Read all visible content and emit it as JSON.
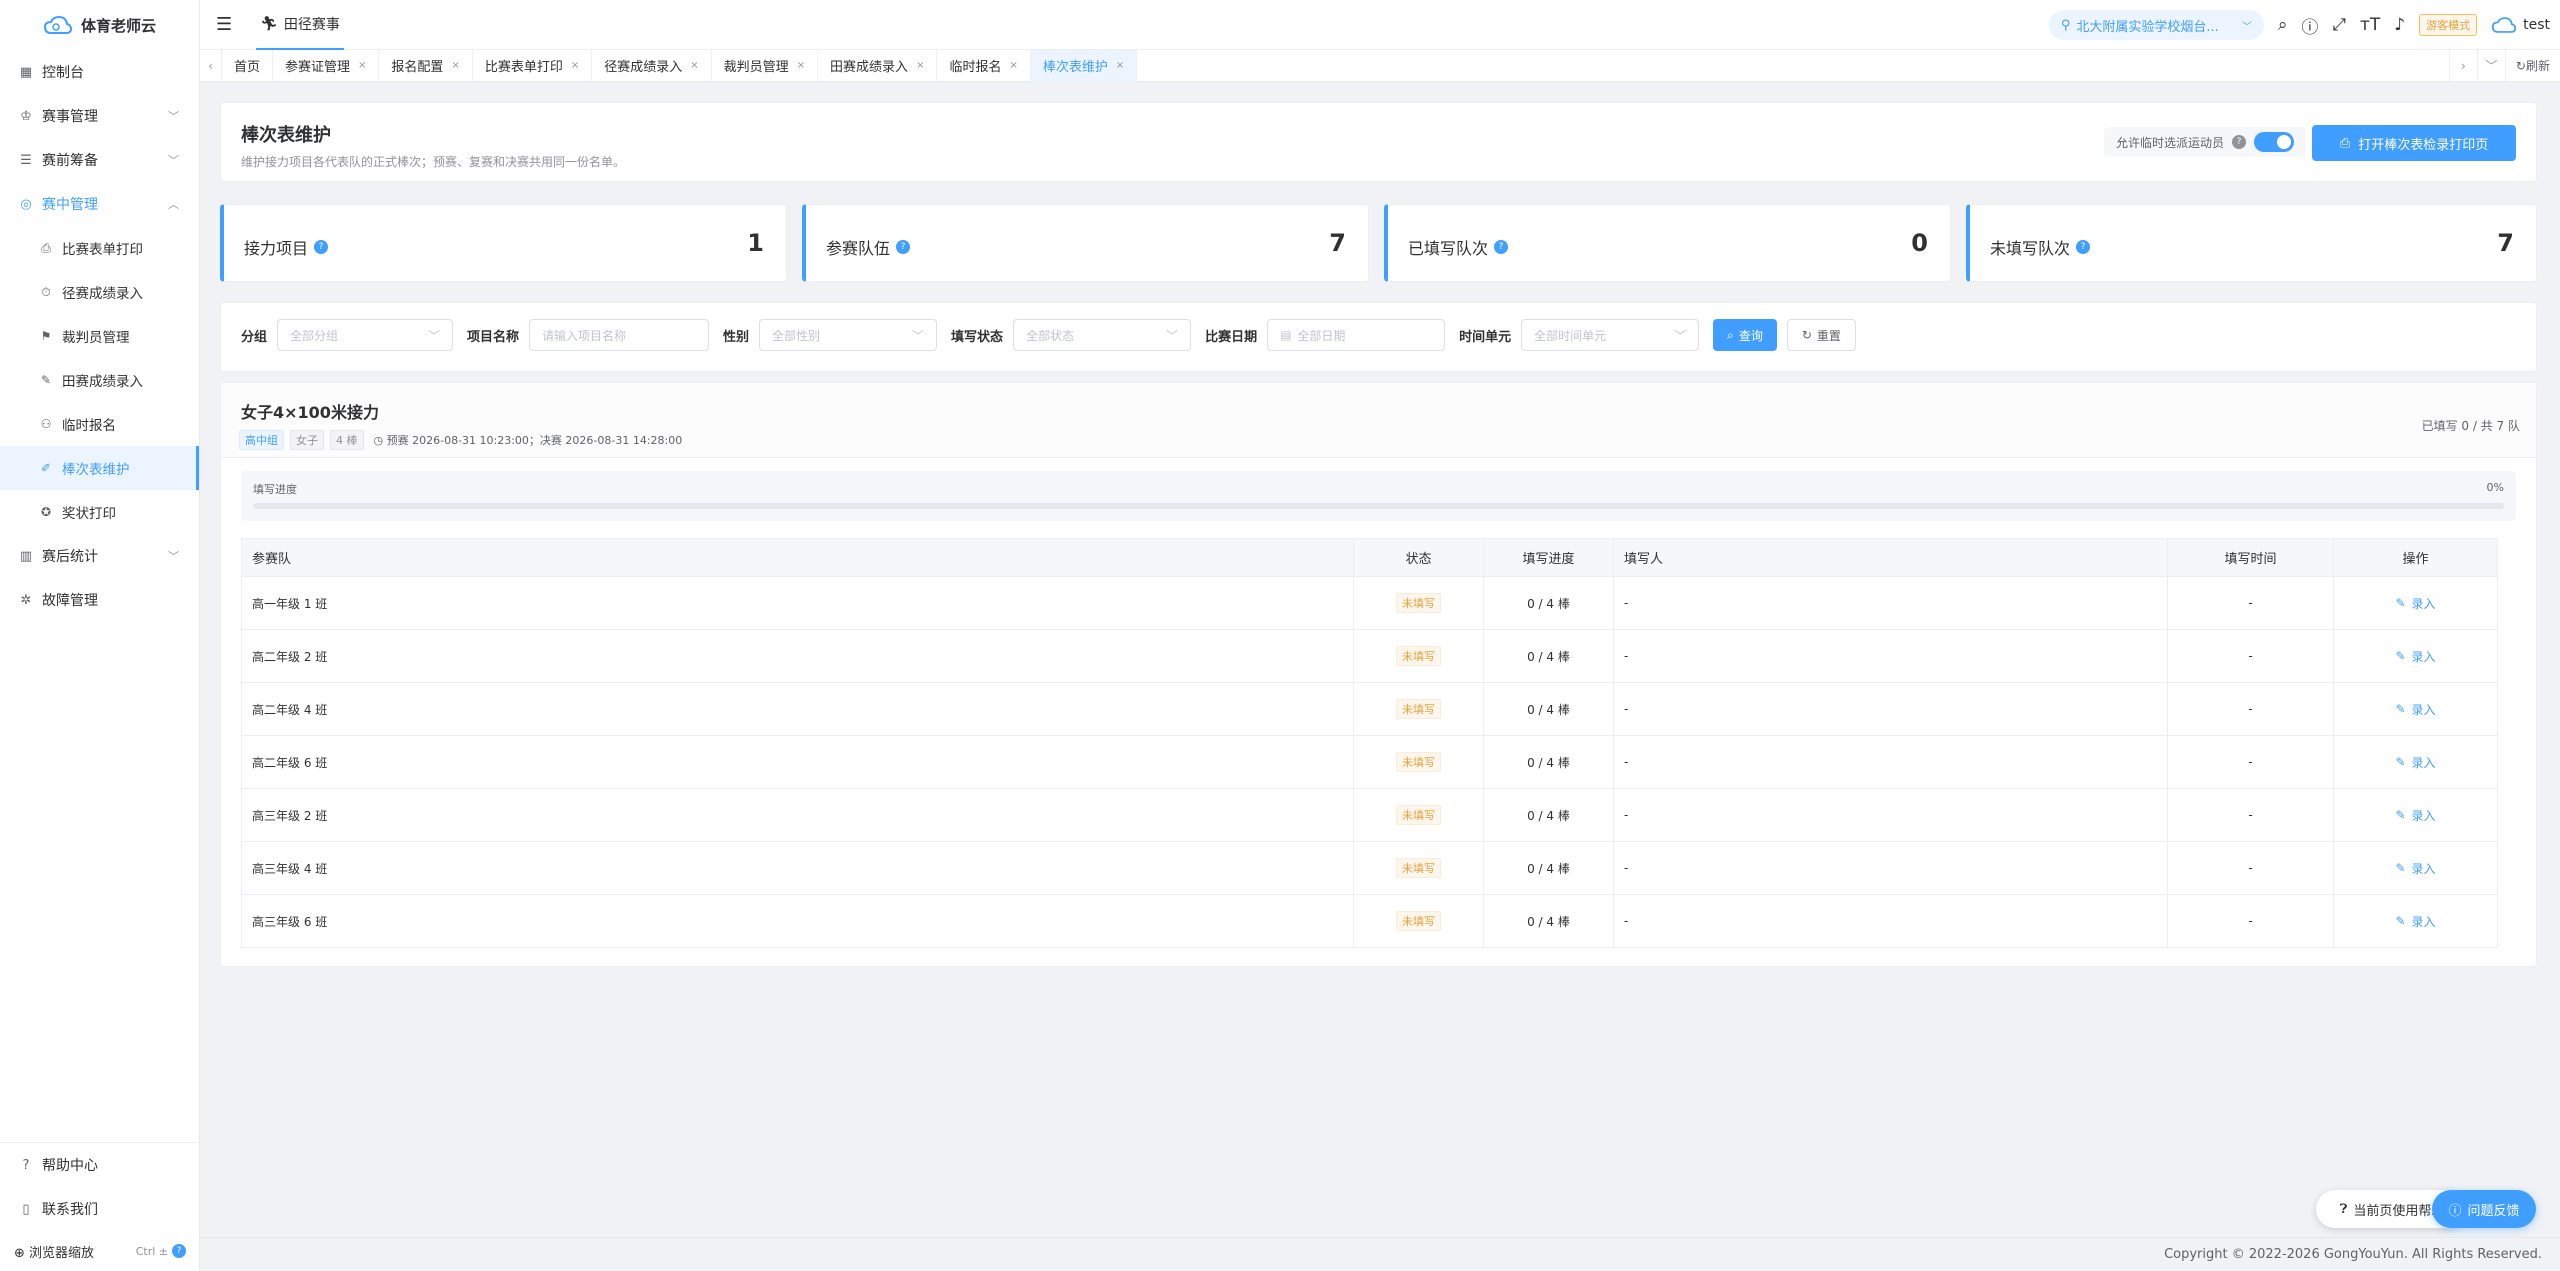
{
  "app": {
    "name": "体育老师云"
  },
  "sidebar": {
    "items": [
      {
        "label": "控制台",
        "icon": "dashboard-icon"
      },
      {
        "label": "赛事管理",
        "icon": "trophy-icon"
      },
      {
        "label": "赛前筹备",
        "icon": "prep-icon"
      },
      {
        "label": "赛中管理",
        "icon": "in-match-icon"
      },
      {
        "label": "赛后统计",
        "icon": "stats-icon"
      },
      {
        "label": "故障管理",
        "icon": "bug-icon"
      }
    ],
    "sub_items": [
      {
        "label": "比赛表单打印"
      },
      {
        "label": "径赛成绩录入"
      },
      {
        "label": "裁判员管理"
      },
      {
        "label": "田赛成绩录入"
      },
      {
        "label": "临时报名"
      },
      {
        "label": "棒次表维护"
      },
      {
        "label": "奖状打印"
      }
    ],
    "bottom": [
      {
        "label": "帮助中心"
      },
      {
        "label": "联系我们"
      }
    ],
    "zoom": {
      "label": "浏览器缩放",
      "hint": "Ctrl ±"
    }
  },
  "topbar": {
    "current_module": "田径赛事",
    "school": "北大附属实验学校烟台...",
    "mode": "游客模式",
    "user": "test"
  },
  "tags": [
    {
      "label": "首页"
    },
    {
      "label": "参赛证管理"
    },
    {
      "label": "报名配置"
    },
    {
      "label": "比赛表单打印"
    },
    {
      "label": "径赛成绩录入"
    },
    {
      "label": "裁判员管理"
    },
    {
      "label": "田赛成绩录入"
    },
    {
      "label": "临时报名"
    },
    {
      "label": "棒次表维护"
    }
  ],
  "tags_refresh": "刷新",
  "page": {
    "title": "棒次表维护",
    "subtitle": "维护接力项目各代表队的正式棒次；预赛、复赛和决赛共用同一份名单。",
    "toggle_label": "允许临时选派运动员",
    "toggle_on": true,
    "print_button": "打开棒次表检录打印页"
  },
  "stats": [
    {
      "label": "接力项目",
      "value": "1"
    },
    {
      "label": "参赛队伍",
      "value": "7"
    },
    {
      "label": "已填写队次",
      "value": "0"
    },
    {
      "label": "未填写队次",
      "value": "7"
    }
  ],
  "filters": {
    "group_label": "分组",
    "group_placeholder": "全部分组",
    "name_label": "项目名称",
    "name_placeholder": "请输入项目名称",
    "gender_label": "性别",
    "gender_placeholder": "全部性别",
    "status_label": "填写状态",
    "status_placeholder": "全部状态",
    "date_label": "比赛日期",
    "date_placeholder": "全部日期",
    "unit_label": "时间单元",
    "unit_placeholder": "全部时间单元",
    "search_btn": "查询",
    "reset_btn": "重置"
  },
  "event": {
    "title": "女子4×100米接力",
    "tags": [
      "高中组",
      "女子",
      "4 棒"
    ],
    "schedule": "预赛 2026-08-31 10:23:00；决赛 2026-08-31 14:28:00",
    "fill_summary": "已填写 0 / 共 7 队",
    "progress_label": "填写进度",
    "progress_pct": "0%",
    "progress_value": 0
  },
  "table": {
    "headers": [
      "参赛队",
      "状态",
      "填写进度",
      "填写人",
      "填写时间",
      "操作"
    ],
    "rows": [
      {
        "team": "高一年级 1 班",
        "status": "未填写",
        "progress": "0 / 4 棒",
        "filler": "-",
        "time": "-",
        "action": "录入"
      },
      {
        "team": "高二年级 2 班",
        "status": "未填写",
        "progress": "0 / 4 棒",
        "filler": "-",
        "time": "-",
        "action": "录入"
      },
      {
        "team": "高二年级 4 班",
        "status": "未填写",
        "progress": "0 / 4 棒",
        "filler": "-",
        "time": "-",
        "action": "录入"
      },
      {
        "team": "高二年级 6 班",
        "status": "未填写",
        "progress": "0 / 4 棒",
        "filler": "-",
        "time": "-",
        "action": "录入"
      },
      {
        "team": "高三年级 2 班",
        "status": "未填写",
        "progress": "0 / 4 棒",
        "filler": "-",
        "time": "-",
        "action": "录入"
      },
      {
        "team": "高三年级 4 班",
        "status": "未填写",
        "progress": "0 / 4 棒",
        "filler": "-",
        "time": "-",
        "action": "录入"
      },
      {
        "team": "高三年级 6 班",
        "status": "未填写",
        "progress": "0 / 4 棒",
        "filler": "-",
        "time": "-",
        "action": "录入"
      }
    ]
  },
  "float": {
    "help": "当前页使用帮助",
    "feedback": "问题反馈"
  },
  "footer": {
    "copyright": "Copyright © 2022-2026 GongYouYun. All Rights Reserved."
  },
  "colors": {
    "primary": "#409eff",
    "warning": "#e6a23c"
  }
}
